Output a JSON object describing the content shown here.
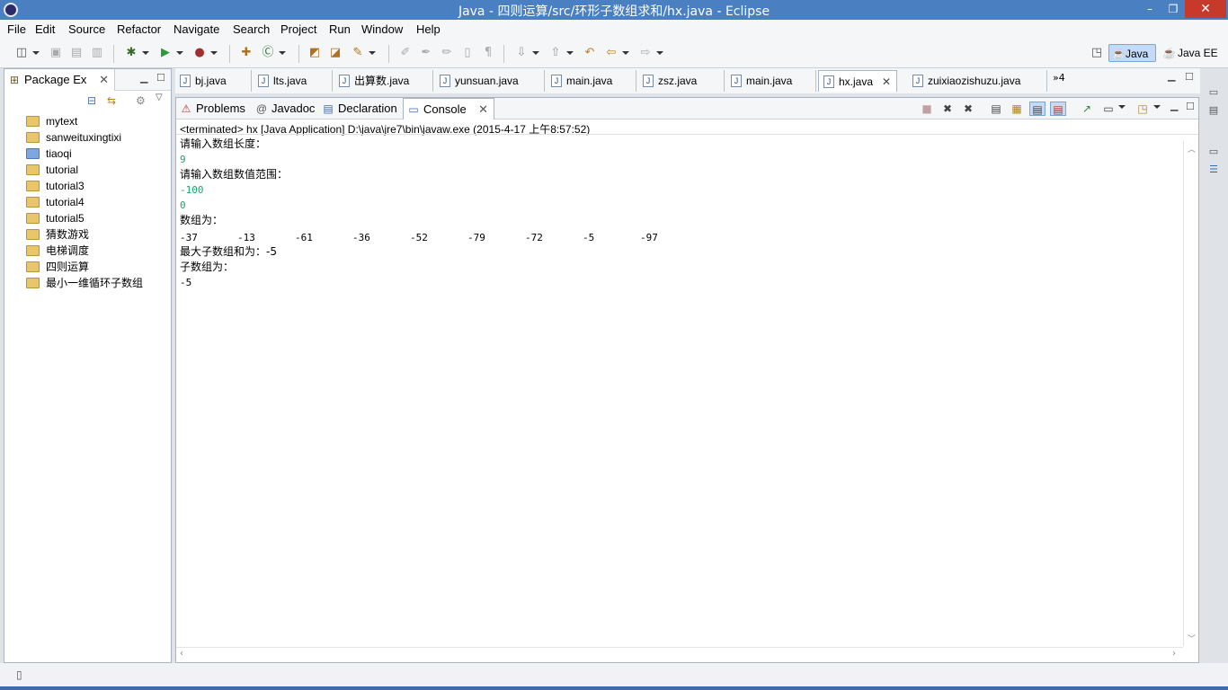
{
  "window": {
    "title": "Java - 四则运算/src/环形子数组求和/hx.java - Eclipse",
    "min": "–",
    "max": "❐",
    "close": "✕"
  },
  "menu": [
    "File",
    "Edit",
    "Source",
    "Refactor",
    "Navigate",
    "Search",
    "Project",
    "Run",
    "Window",
    "Help"
  ],
  "perspectives": {
    "java": "Java",
    "javaee": "Java EE"
  },
  "package_explorer": {
    "tab_label": "Package Ex",
    "projects": [
      {
        "name": "mytext",
        "closed": false
      },
      {
        "name": "sanweituxingtixi",
        "closed": false
      },
      {
        "name": "tiaoqi",
        "closed": true
      },
      {
        "name": "tutorial",
        "closed": false
      },
      {
        "name": "tutorial3",
        "closed": false
      },
      {
        "name": "tutorial4",
        "closed": false
      },
      {
        "name": "tutorial5",
        "closed": false
      },
      {
        "name": "猜数游戏",
        "closed": false
      },
      {
        "name": "电梯调度",
        "closed": false
      },
      {
        "name": "四则运算",
        "closed": false
      },
      {
        "name": "最小一维循环子数组",
        "closed": false
      }
    ]
  },
  "editor_tabs": [
    "bj.java",
    "lts.java",
    "出算数.java",
    "yunsuan.java",
    "main.java",
    "zsz.java",
    "main.java",
    "hx.java",
    "zuixiaozishuzu.java"
  ],
  "editor_overflow": "»4",
  "console_tabs": [
    "Problems",
    "Javadoc",
    "Declaration",
    "Console"
  ],
  "console": {
    "header": "<terminated> hx [Java Application] D:\\java\\jre7\\bin\\javaw.exe (2015-4-17 上午8:57:52)",
    "prompt_length": "请输入数组长度：",
    "input_length": "9",
    "prompt_range": "请输入数组数值范围：",
    "input_min": "-100",
    "input_max": "0",
    "array_label": "数组为：",
    "array_values": [
      "-37",
      "-13",
      "-61",
      "-36",
      "-52",
      "-79",
      "-72",
      "-5",
      "-97"
    ],
    "max_sum_line": "最大子数组和为：-5",
    "subarray_label": "子数组为：",
    "subarray_values": "-5"
  },
  "icons": {
    "close": "✕"
  }
}
